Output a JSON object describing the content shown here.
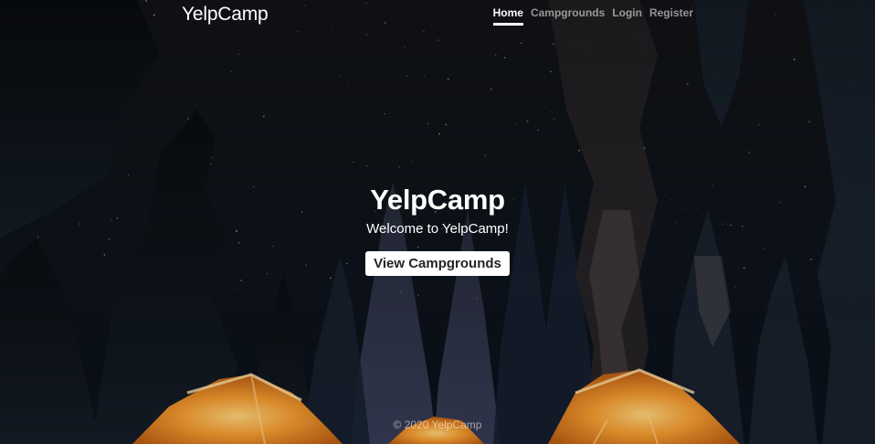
{
  "navbar": {
    "brand": "YelpCamp",
    "links": [
      {
        "label": "Home",
        "active": true
      },
      {
        "label": "Campgrounds",
        "active": false
      },
      {
        "label": "Login",
        "active": false
      },
      {
        "label": "Register",
        "active": false
      }
    ]
  },
  "cover": {
    "title": "YelpCamp",
    "lead": "Welcome to YelpCamp!",
    "button_label": "View Campgrounds"
  },
  "footer": {
    "text": "© 2020 YelpCamp"
  },
  "colors": {
    "tent": "#e8892a",
    "sky": "#12161c",
    "button_bg": "#ffffff",
    "button_text": "#212529"
  }
}
